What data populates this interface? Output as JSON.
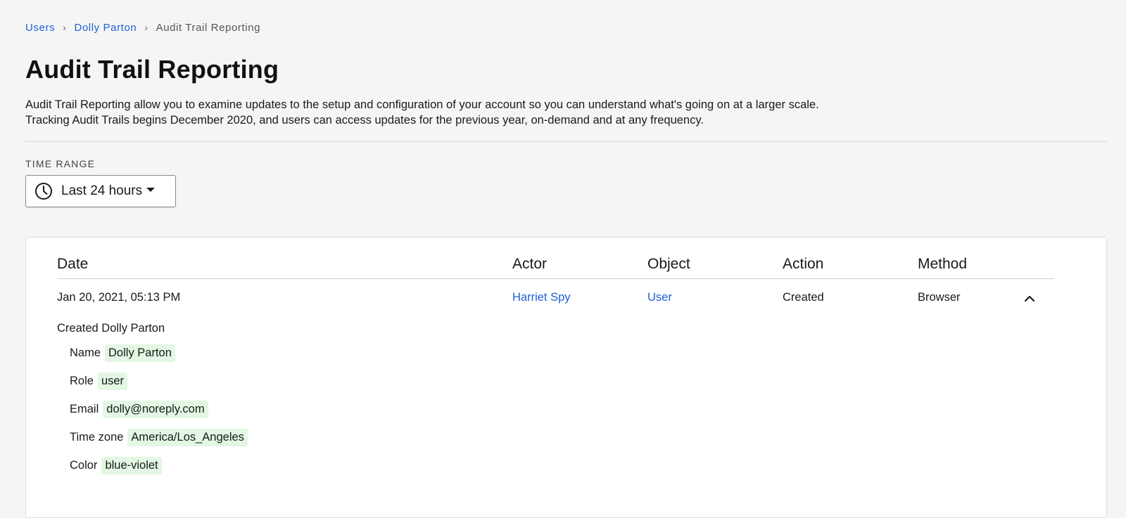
{
  "breadcrumb": {
    "users": "Users",
    "user": "Dolly Parton",
    "current": "Audit Trail Reporting",
    "separator": "›"
  },
  "page": {
    "title": "Audit Trail Reporting",
    "description": "Audit Trail Reporting allow you to examine updates to the setup and configuration of your account so you can understand what's going on at a larger scale. Tracking Audit Trails begins December 2020, and users can access updates for the previous year, on-demand and at any frequency."
  },
  "time_range": {
    "label": "TIME RANGE",
    "value": "Last 24 hours",
    "icon": "clock-icon"
  },
  "table": {
    "headers": {
      "date": "Date",
      "actor": "Actor",
      "object": "Object",
      "action": "Action",
      "method": "Method"
    },
    "row": {
      "date": "Jan 20, 2021, 05:13 PM",
      "actor": "Harriet Spy",
      "object": "User",
      "action": "Created",
      "method": "Browser",
      "expand_icon": "chevron-up-icon"
    },
    "details": {
      "title": "Created Dolly Parton",
      "fields": [
        {
          "label": "Name",
          "value": "Dolly Parton"
        },
        {
          "label": "Role",
          "value": "user"
        },
        {
          "label": "Email",
          "value": "dolly@noreply.com"
        },
        {
          "label": "Time zone",
          "value": "America/Los_Angeles"
        },
        {
          "label": "Color",
          "value": "blue-violet"
        }
      ]
    }
  },
  "colors": {
    "link": "#1f5fd6",
    "background": "#f5f5f5",
    "value_highlight": "#e3f7e3"
  }
}
